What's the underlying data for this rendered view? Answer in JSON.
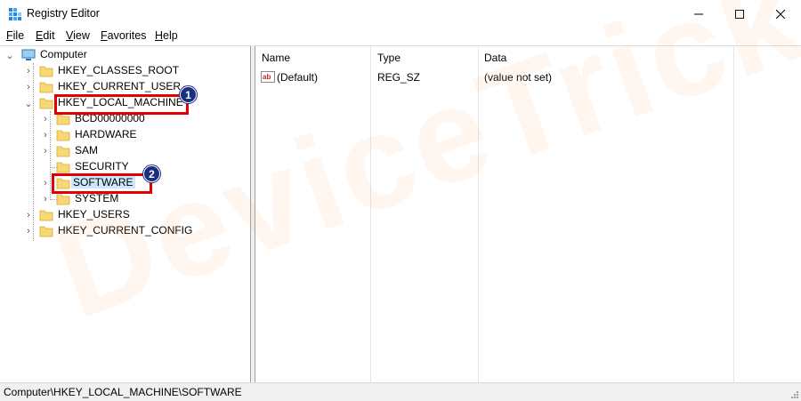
{
  "window": {
    "title": "Registry Editor"
  },
  "menu": [
    {
      "label_underlined": "F",
      "label_rest": "ile"
    },
    {
      "label_underlined": "E",
      "label_rest": "dit"
    },
    {
      "label_underlined": "V",
      "label_rest": "iew"
    },
    {
      "label_underlined": "F",
      "label_rest": "avorites"
    },
    {
      "label_underlined": "H",
      "label_rest": "elp"
    }
  ],
  "tree": {
    "root": "Computer",
    "nodes": [
      {
        "label": "HKEY_CLASSES_ROOT"
      },
      {
        "label": "HKEY_CURRENT_USER"
      },
      {
        "label": "HKEY_LOCAL_MACHINE"
      },
      {
        "label": "BCD00000000"
      },
      {
        "label": "HARDWARE"
      },
      {
        "label": "SAM"
      },
      {
        "label": "SECURITY"
      },
      {
        "label": "SOFTWARE"
      },
      {
        "label": "SYSTEM"
      },
      {
        "label": "HKEY_USERS"
      },
      {
        "label": "HKEY_CURRENT_CONFIG"
      }
    ],
    "selected": "SOFTWARE"
  },
  "callouts": [
    {
      "number": "1"
    },
    {
      "number": "2"
    }
  ],
  "list": {
    "columns": [
      "Name",
      "Type",
      "Data"
    ],
    "rows": [
      {
        "name": "(Default)",
        "type": "REG_SZ",
        "data": "(value not set)",
        "icon": "string-value-icon"
      }
    ]
  },
  "status": {
    "path": "Computer\\HKEY_LOCAL_MACHINE\\SOFTWARE"
  },
  "watermark": "DeviceTricks",
  "colors": {
    "callout": "#e00000",
    "badge": "#1a2f80",
    "selection": "#cce8ff",
    "folder": "#f8d775"
  }
}
